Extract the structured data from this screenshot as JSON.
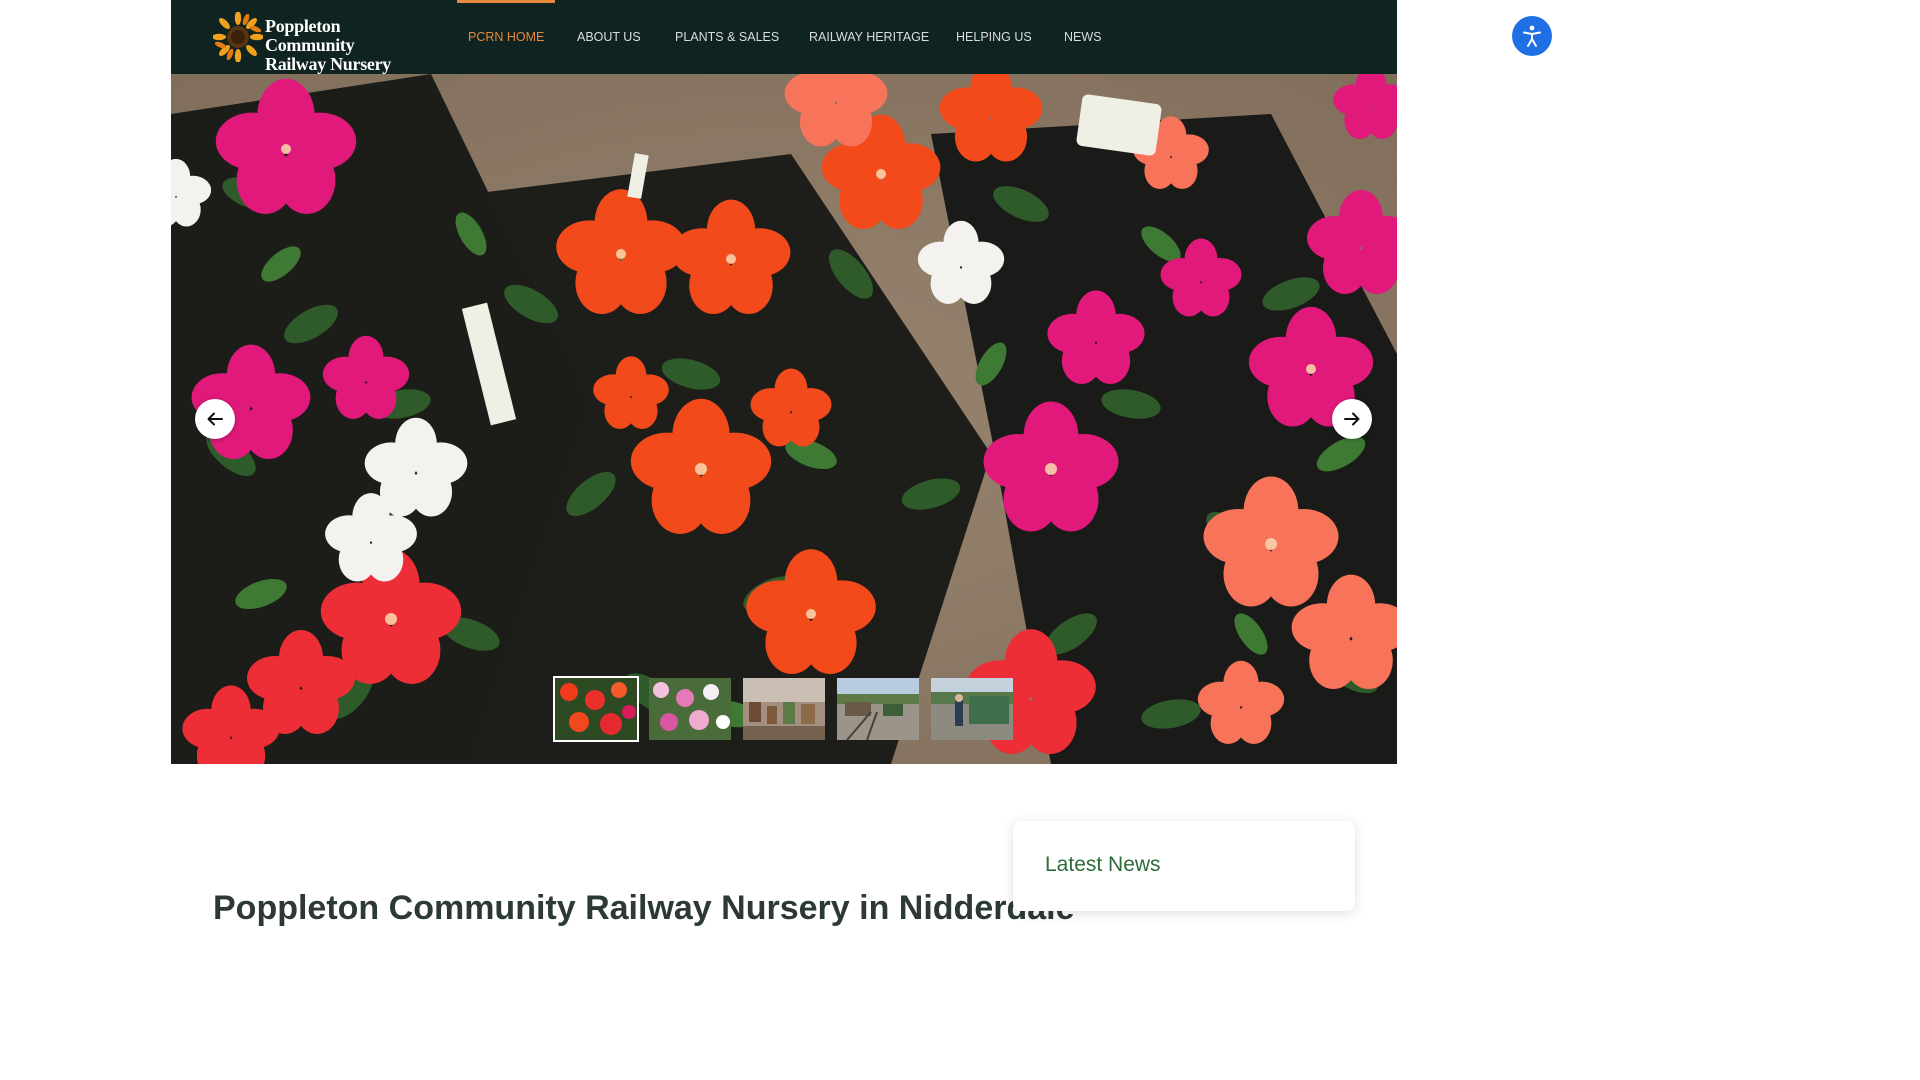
{
  "brand": {
    "line1": "Poppleton Community",
    "line2": "Railway Nursery",
    "logo_icon": "sunflower-logo-icon"
  },
  "nav": {
    "items": [
      {
        "label": "PCRN HOME",
        "active": true
      },
      {
        "label": "ABOUT US",
        "active": false
      },
      {
        "label": "PLANTS & SALES",
        "active": false
      },
      {
        "label": "RAILWAY HERITAGE",
        "active": false
      },
      {
        "label": "HELPING US",
        "active": false
      },
      {
        "label": "NEWS",
        "active": false
      }
    ],
    "active_color": "#e58a3e"
  },
  "slider": {
    "prev_icon": "arrow-left-icon",
    "next_icon": "arrow-right-icon",
    "active_index": 0,
    "thumbnails": [
      {
        "subject": "red and orange busy lizzie flowers"
      },
      {
        "subject": "pink and white busy lizzie flowers"
      },
      {
        "subject": "potted plants on nursery shelving"
      },
      {
        "subject": "railway track and nursery yard"
      },
      {
        "subject": "visitor beside green locomotive"
      }
    ]
  },
  "main": {
    "heading": "Poppleton Community Railway Nursery in Nidderdale"
  },
  "sidebar": {
    "news_title": "Latest News"
  },
  "accessibility": {
    "icon": "accessibility-person-icon",
    "color": "#1f6fe5"
  },
  "colors": {
    "header_bg": "#0f2321",
    "news_title": "#2e6b3a"
  }
}
